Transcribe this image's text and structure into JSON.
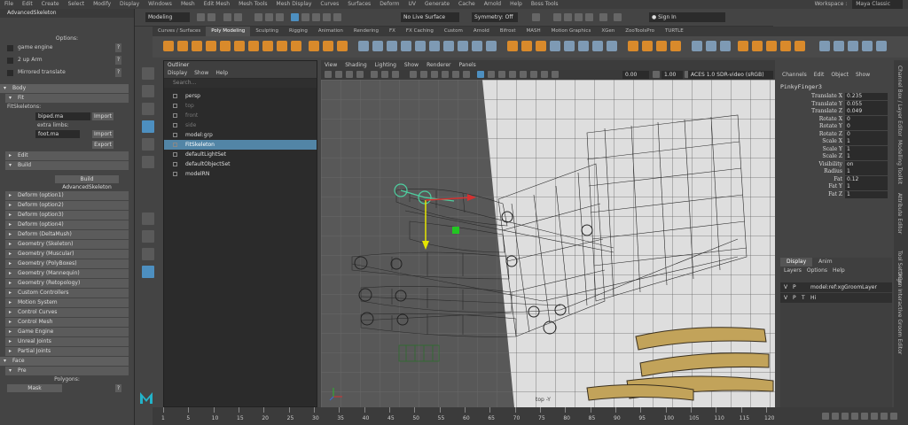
{
  "menu": [
    "File",
    "Edit",
    "Create",
    "Select",
    "Modify",
    "Display",
    "Windows",
    "Mesh",
    "Edit Mesh",
    "Mesh Tools",
    "Mesh Display",
    "Curves",
    "Surfaces",
    "Deform",
    "UV",
    "Generate",
    "Cache",
    "Arnold",
    "Help",
    "Boss Tools"
  ],
  "workspace": {
    "label": "Workspace :",
    "value": "Maya Classic"
  },
  "status": {
    "mode": "Modeling",
    "live_surface": "No Live Surface",
    "symmetry": "Symmetry: Off",
    "sign_in": "Sign In"
  },
  "shelf_tabs": [
    "Curves / Surfaces",
    "Poly Modeling",
    "Sculpting",
    "Rigging",
    "Animation",
    "Rendering",
    "FX",
    "FX Caching",
    "Custom",
    "Arnold",
    "Bifrost",
    "MASH",
    "Motion Graphics",
    "XGen",
    "ZooToolsPro",
    "TURTLE"
  ],
  "shelf_active": "Poly Modeling",
  "left_panel": {
    "title": "AdvancedSkeleton",
    "options_header": "Options:",
    "options": [
      {
        "label": "game engine",
        "q": "?"
      },
      {
        "label": "2 up Arm",
        "q": "?"
      },
      {
        "label": "Mirrored translate",
        "q": "?"
      }
    ],
    "body": "Body",
    "fit": "Fit",
    "fit_skeletons": "FitSkeletons:",
    "biped": "biped.ma",
    "import1": "Import",
    "extra_limbs": "extra limbs:",
    "foot": "foot.ma",
    "import2": "Import",
    "export": "Export",
    "edit": "Edit",
    "build": "Build",
    "build_button": "Build AdvancedSkeleton",
    "deform_items": [
      "Deform      (option1)",
      "Deform      (option2)",
      "Deform      (option3)",
      "Deform      (option4)",
      "Deform      (DeltaMush)",
      "Geometry (Skeleton)",
      "Geometry (Muscular)",
      "Geometry (PolyBoxes)",
      "Geometry (Mannequin)",
      "Geometry (Retopology)",
      "Custom Controllers",
      "Motion System",
      "Control Curves",
      "Control Mesh",
      "Game Engine",
      "Unreal Joints",
      "Partial Joints"
    ],
    "face": "Face",
    "pre": "Pre",
    "polygons": "Polygons:",
    "mask": "Mask",
    "mask_q": "?"
  },
  "outliner": {
    "title": "Outliner",
    "menu": [
      "Display",
      "Show",
      "Help"
    ],
    "search": "Search...",
    "items": [
      {
        "label": "persp",
        "dim": false
      },
      {
        "label": "top",
        "dim": true
      },
      {
        "label": "front",
        "dim": true
      },
      {
        "label": "side",
        "dim": true
      },
      {
        "label": "model:grp",
        "dim": false
      },
      {
        "label": "FitSkeleton",
        "dim": false,
        "sel": true
      },
      {
        "label": "defaultLightSet",
        "dim": false
      },
      {
        "label": "defaultObjectSet",
        "dim": false
      },
      {
        "label": "modelRN",
        "dim": false
      }
    ]
  },
  "viewport": {
    "menu": [
      "View",
      "Shading",
      "Lighting",
      "Show",
      "Renderer",
      "Panels"
    ],
    "field1": "0.00",
    "field2": "1.00",
    "color_space": "ACES 1.0 SDR-video (sRGB)",
    "label_bottom": "top -Y"
  },
  "channel_box": {
    "tabs": [
      "Channels",
      "Edit",
      "Object",
      "Show"
    ],
    "object": "PinkyFinger3",
    "attrs": [
      {
        "name": "Translate X",
        "value": "0.235"
      },
      {
        "name": "Translate Y",
        "value": "0.055"
      },
      {
        "name": "Translate Z",
        "value": "0.049"
      },
      {
        "name": "Rotate X",
        "value": "0"
      },
      {
        "name": "Rotate Y",
        "value": "0"
      },
      {
        "name": "Rotate Z",
        "value": "0"
      },
      {
        "name": "Scale X",
        "value": "1"
      },
      {
        "name": "Scale Y",
        "value": "1"
      },
      {
        "name": "Scale Z",
        "value": "1"
      },
      {
        "name": "Visibility",
        "value": "on"
      },
      {
        "name": "Radius",
        "value": "1"
      },
      {
        "name": "Fat",
        "value": "0.12"
      },
      {
        "name": "Fat Y",
        "value": "1"
      },
      {
        "name": "Fat Z",
        "value": "1"
      }
    ],
    "layer_tabs": [
      "Display",
      "Anim"
    ],
    "layer_menu": [
      "Layers",
      "Options",
      "Help"
    ],
    "layers": [
      {
        "v": "V",
        "p": "P",
        "t": "",
        "name": "model:ref:xgGroomLayer"
      },
      {
        "v": "V",
        "p": "P",
        "t": "T",
        "name": "Hi"
      }
    ]
  },
  "side_tabs": [
    "Channel Box / Layer Editor",
    "Modelling Toolkit",
    "Attribute Editor",
    "Tool Settings",
    "XGen Interactive Groom Editor"
  ],
  "timeline": {
    "ticks": [
      "1",
      "5",
      "10",
      "15",
      "20",
      "25",
      "30",
      "35",
      "40",
      "45",
      "50",
      "55",
      "60",
      "65",
      "70",
      "75",
      "80",
      "85",
      "90",
      "95",
      "100",
      "105",
      "110",
      "115",
      "120"
    ]
  },
  "colors": {
    "accent": "#4d8fc0",
    "selection": "#5285a6",
    "shelf_icon": "#d98a2b"
  }
}
